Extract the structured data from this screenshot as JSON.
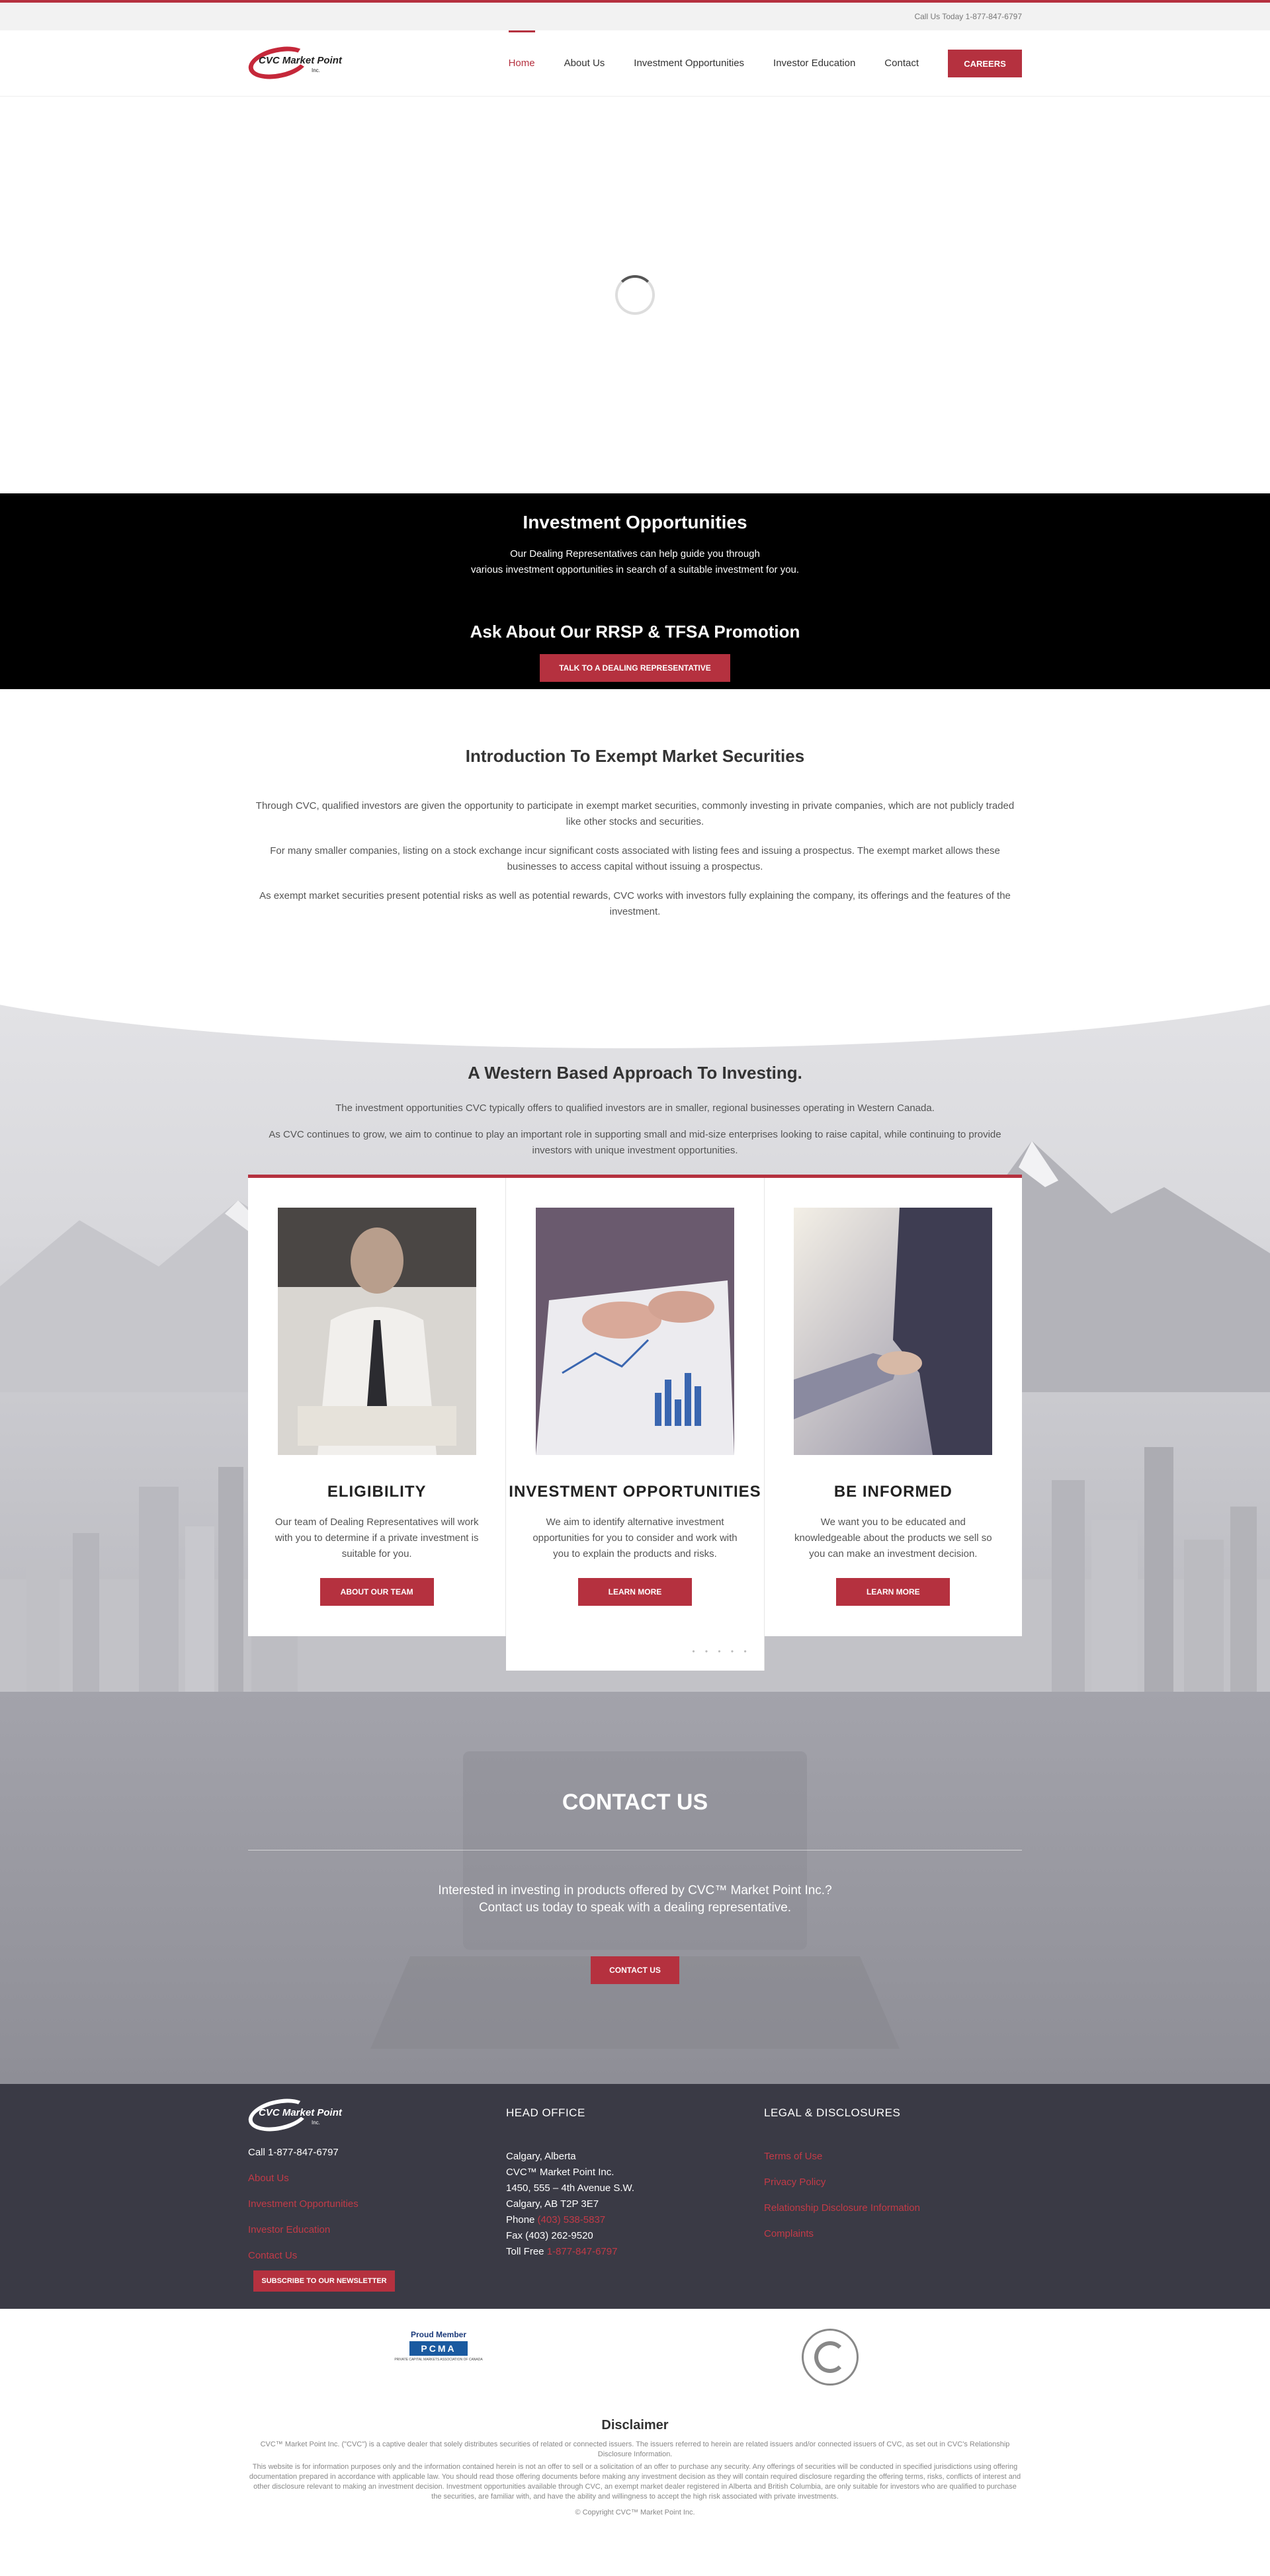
{
  "topbar": {
    "phone_text": "Call Us Today 1-877-847-6797"
  },
  "header": {
    "logo_text": "CVC Market Point",
    "logo_inc": "Inc.",
    "nav": [
      "Home",
      "About Us",
      "Investment Opportunities",
      "Investor Education",
      "Contact"
    ],
    "careers_label": "CAREERS"
  },
  "black_band": {
    "title": "Investment Opportunities",
    "line1": "Our Dealing Representatives can help guide you through",
    "line2": "various investment opportunities in search of a suitable investment for you.",
    "promo_title": "Ask About Our RRSP & TFSA Promotion",
    "button_label": "TALK TO A DEALING REPRESENTATIVE"
  },
  "intro": {
    "title": "Introduction To Exempt Market Securities",
    "p1": "Through CVC, qualified investors are given the opportunity to participate in exempt market securities, commonly investing in private companies, which are not publicly traded like other stocks and securities.",
    "p2": "For many smaller companies, listing on a stock exchange incur significant costs associated with listing fees and issuing a prospectus. The exempt market allows these businesses to access capital without issuing a prospectus.",
    "p3": "As exempt market securities present potential risks as well as potential rewards, CVC works with investors fully explaining the company, its offerings and the features of the investment."
  },
  "western": {
    "title": "A Western Based Approach To Investing.",
    "p1": "The investment opportunities CVC typically offers to qualified investors are in smaller, regional businesses operating in Western Canada.",
    "p2": "As CVC continues to grow, we aim to continue to play an important role in supporting small and mid-size enterprises looking to raise capital, while continuing to provide investors with unique investment opportunities.",
    "cards": [
      {
        "title": "ELIGIBILITY",
        "text": "Our team of Dealing Representatives will work with you to determine if a private investment is suitable for you.",
        "button": "ABOUT OUR TEAM"
      },
      {
        "title": "INVESTMENT OPPORTUNITIES",
        "text": "We aim to identify alternative investment opportunities for you to consider and work with you to explain the products and risks.",
        "button": "LEARN MORE"
      },
      {
        "title": "BE INFORMED",
        "text": "We want you to be educated and knowledgeable about the products we sell so you can make an investment decision.",
        "button": "LEARN MORE"
      }
    ],
    "dots": "• • • • •"
  },
  "contact": {
    "title": "CONTACT US",
    "line1": "Interested in investing in products offered by CVC™ Market Point Inc.?",
    "line2": "Contact us today to speak with a dealing representative.",
    "button": "CONTACT US"
  },
  "footer": {
    "logo_text": "CVC Market Point",
    "logo_inc": "Inc.",
    "call": "Call 1-877-847-6797",
    "links": [
      "About Us",
      "Investment Opportunities",
      "Investor Education",
      "Contact Us"
    ],
    "newsletter": "SUBSCRIBE TO OUR NEWSLETTER",
    "head_office_title": "HEAD OFFICE",
    "address": [
      "Calgary, Alberta",
      "CVC™ Market Point Inc.",
      "1450, 555 – 4th Avenue S.W.",
      "Calgary, AB T2P 3E7"
    ],
    "phone_label": "Phone ",
    "phone_number": "(403) 538-5837",
    "fax": "Fax (403) 262-9520",
    "tollfree_label": "Toll Free ",
    "tollfree_number": "1-877-847-6797",
    "legal_title": "LEGAL & DISCLOSURES",
    "legal_links": [
      "Terms of Use",
      "Privacy Policy",
      "Relationship Disclosure Information",
      "Complaints"
    ]
  },
  "badges": {
    "pcma_top": "Proud Member",
    "pcma_box": "PCMA",
    "pcma_sub": "PRIVATE CAPITAL MARKETS ASSOCIATION OF CANADA"
  },
  "disclaimer": {
    "title": "Disclaimer",
    "p1": "CVC™ Market Point Inc. (\"CVC\") is a captive dealer that solely distributes securities of related or connected issuers. The issuers referred to herein are related issuers and/or connected issuers of CVC, as set out in CVC's Relationship Disclosure Information.",
    "p2": "This website is for information purposes only and the information contained herein is not an offer to sell or a solicitation of an offer to purchase any security. Any offerings of securities will be conducted in specified jurisdictions using offering documentation prepared in accordance with applicable law. You should read those offering documents before making any investment decision as they will contain required disclosure regarding the offering terms, risks, conflicts of interest and other disclosure relevant to making an investment decision. Investment opportunities available through CVC, an exempt market dealer registered in Alberta and British Columbia, are only suitable for investors who are qualified to purchase the securities, are familiar with, and have the ability and willingness to accept the high risk associated with private investments.",
    "copyright": "© Copyright CVC™ Market Point Inc."
  }
}
